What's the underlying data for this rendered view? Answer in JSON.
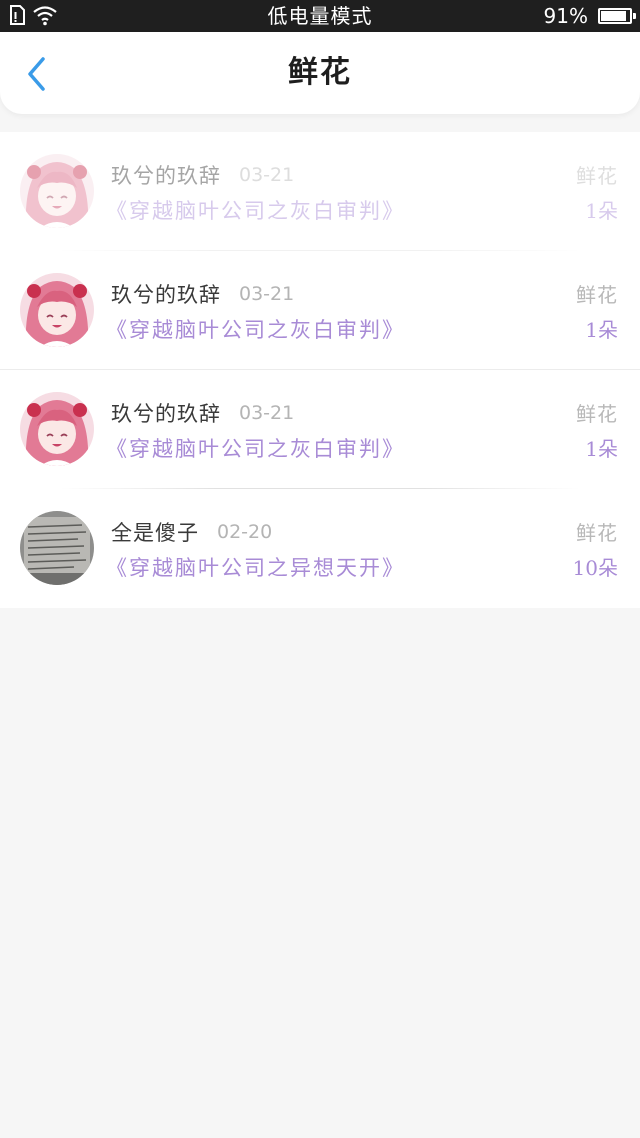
{
  "status_bar": {
    "mode_text": "低电量模式",
    "battery_text": "91%",
    "battery_level": 0.91
  },
  "header": {
    "title": "鲜花",
    "back_icon": "chevron-left-icon"
  },
  "colors": {
    "accent": "#3a9be8",
    "book_text": "#a88bd6",
    "muted": "#b4b4b4"
  },
  "records": [
    {
      "username": "玖兮的玖辞",
      "date": "03-21",
      "book": "《穿越脑叶公司之灰白审判》",
      "gift_type": "鲜花",
      "gift_count": "1朵",
      "avatar": "anime-girl-avatar"
    },
    {
      "username": "玖兮的玖辞",
      "date": "03-21",
      "book": "《穿越脑叶公司之灰白审判》",
      "gift_type": "鲜花",
      "gift_count": "1朵",
      "avatar": "anime-girl-avatar"
    },
    {
      "username": "玖兮的玖辞",
      "date": "03-21",
      "book": "《穿越脑叶公司之灰白审判》",
      "gift_type": "鲜花",
      "gift_count": "1朵",
      "avatar": "anime-girl-avatar"
    },
    {
      "username": "全是傻子",
      "date": "02-20",
      "book": "《穿越脑叶公司之异想天开》",
      "gift_type": "鲜花",
      "gift_count": "10朵",
      "avatar": "notebook-photo-avatar"
    }
  ]
}
